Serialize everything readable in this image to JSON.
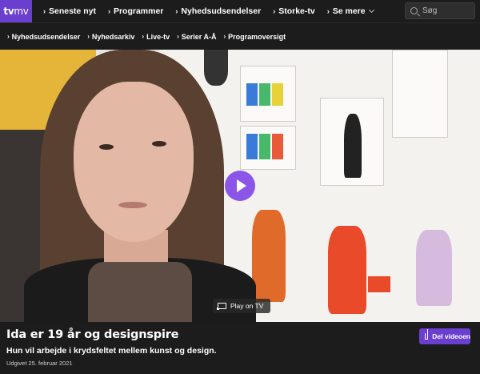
{
  "logo": {
    "tv": "tv",
    "mv": "mv"
  },
  "topnav": [
    {
      "label": "Seneste nyt"
    },
    {
      "label": "Programmer"
    },
    {
      "label": "Nyhedsudsendelser"
    },
    {
      "label": "Storke-tv"
    },
    {
      "label": "Se mere"
    }
  ],
  "search": {
    "placeholder": "Søg"
  },
  "subnav": [
    {
      "label": "Nyhedsudsendelser"
    },
    {
      "label": "Nyhedsarkiv"
    },
    {
      "label": "Live-tv"
    },
    {
      "label": "Serier A-Å"
    },
    {
      "label": "Programoversigt"
    }
  ],
  "video": {
    "cast_label": "Play on TV"
  },
  "article": {
    "title": "Ida er 19 år og designspire",
    "subtitle": "Hun vil arbejde i krydsfeltet mellem kunst og design.",
    "date": "Udgivet 25. februar 2021",
    "share_label": "Del videoen"
  },
  "colors": {
    "brand_purple": "#6a3fd0",
    "play_purple": "#8b55e8",
    "background": "#1c1c1c"
  }
}
